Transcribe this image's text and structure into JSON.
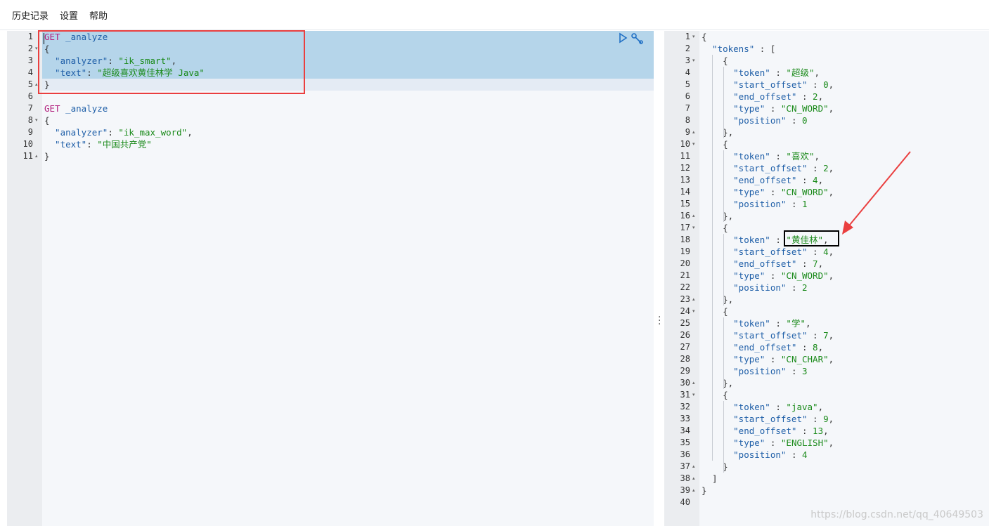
{
  "menu": [
    "历史记录",
    "设置",
    "帮助"
  ],
  "request": {
    "lines": [
      {
        "n": "1",
        "fold": "",
        "parts": [
          {
            "c": "k-get",
            "t": "GET"
          },
          {
            "c": "k-path",
            "t": " _analyze"
          }
        ]
      },
      {
        "n": "2",
        "fold": "▾",
        "parts": [
          {
            "c": "k-punct",
            "t": "{"
          }
        ]
      },
      {
        "n": "3",
        "fold": "",
        "parts": [
          {
            "c": "k-key",
            "t": "  \"analyzer\""
          },
          {
            "c": "k-punct",
            "t": ": "
          },
          {
            "c": "k-str",
            "t": "\"ik_smart\""
          },
          {
            "c": "k-punct",
            "t": ","
          }
        ]
      },
      {
        "n": "4",
        "fold": "",
        "parts": [
          {
            "c": "k-key",
            "t": "  \"text\""
          },
          {
            "c": "k-punct",
            "t": ": "
          },
          {
            "c": "k-str",
            "t": "\"超级喜欢黄佳林学 Java\""
          }
        ]
      },
      {
        "n": "5",
        "fold": "▴",
        "parts": [
          {
            "c": "k-punct",
            "t": "}"
          }
        ]
      },
      {
        "n": "6",
        "fold": "",
        "parts": []
      },
      {
        "n": "7",
        "fold": "",
        "parts": [
          {
            "c": "k-get",
            "t": "GET"
          },
          {
            "c": "k-path",
            "t": " _analyze"
          }
        ]
      },
      {
        "n": "8",
        "fold": "▾",
        "parts": [
          {
            "c": "k-punct",
            "t": "{"
          }
        ]
      },
      {
        "n": "9",
        "fold": "",
        "parts": [
          {
            "c": "k-key",
            "t": "  \"analyzer\""
          },
          {
            "c": "k-punct",
            "t": ": "
          },
          {
            "c": "k-str",
            "t": "\"ik_max_word\""
          },
          {
            "c": "k-punct",
            "t": ","
          }
        ]
      },
      {
        "n": "10",
        "fold": "",
        "parts": [
          {
            "c": "k-key",
            "t": "  \"text\""
          },
          {
            "c": "k-punct",
            "t": ": "
          },
          {
            "c": "k-str",
            "t": "\"中国共产党\""
          }
        ]
      },
      {
        "n": "11",
        "fold": "▴",
        "parts": [
          {
            "c": "k-punct",
            "t": "}"
          }
        ]
      }
    ]
  },
  "response": {
    "lines": [
      {
        "n": "1",
        "fold": "▾",
        "parts": [
          {
            "c": "k-punct",
            "t": "{"
          }
        ]
      },
      {
        "n": "2",
        "fold": "",
        "parts": [
          {
            "c": "k-key",
            "t": "  \"tokens\""
          },
          {
            "c": "k-punct",
            "t": " : ["
          }
        ]
      },
      {
        "n": "3",
        "fold": "▾",
        "parts": [
          {
            "c": "k-punct",
            "t": "    {"
          }
        ]
      },
      {
        "n": "4",
        "fold": "",
        "parts": [
          {
            "c": "k-key",
            "t": "      \"token\""
          },
          {
            "c": "k-punct",
            "t": " : "
          },
          {
            "c": "k-str",
            "t": "\"超级\""
          },
          {
            "c": "k-punct",
            "t": ","
          }
        ]
      },
      {
        "n": "5",
        "fold": "",
        "parts": [
          {
            "c": "k-key",
            "t": "      \"start_offset\""
          },
          {
            "c": "k-punct",
            "t": " : "
          },
          {
            "c": "k-num",
            "t": "0"
          },
          {
            "c": "k-punct",
            "t": ","
          }
        ]
      },
      {
        "n": "6",
        "fold": "",
        "parts": [
          {
            "c": "k-key",
            "t": "      \"end_offset\""
          },
          {
            "c": "k-punct",
            "t": " : "
          },
          {
            "c": "k-num",
            "t": "2"
          },
          {
            "c": "k-punct",
            "t": ","
          }
        ]
      },
      {
        "n": "7",
        "fold": "",
        "parts": [
          {
            "c": "k-key",
            "t": "      \"type\""
          },
          {
            "c": "k-punct",
            "t": " : "
          },
          {
            "c": "k-str",
            "t": "\"CN_WORD\""
          },
          {
            "c": "k-punct",
            "t": ","
          }
        ]
      },
      {
        "n": "8",
        "fold": "",
        "parts": [
          {
            "c": "k-key",
            "t": "      \"position\""
          },
          {
            "c": "k-punct",
            "t": " : "
          },
          {
            "c": "k-num",
            "t": "0"
          }
        ]
      },
      {
        "n": "9",
        "fold": "▴",
        "parts": [
          {
            "c": "k-punct",
            "t": "    },"
          }
        ]
      },
      {
        "n": "10",
        "fold": "▾",
        "parts": [
          {
            "c": "k-punct",
            "t": "    {"
          }
        ]
      },
      {
        "n": "11",
        "fold": "",
        "parts": [
          {
            "c": "k-key",
            "t": "      \"token\""
          },
          {
            "c": "k-punct",
            "t": " : "
          },
          {
            "c": "k-str",
            "t": "\"喜欢\""
          },
          {
            "c": "k-punct",
            "t": ","
          }
        ]
      },
      {
        "n": "12",
        "fold": "",
        "parts": [
          {
            "c": "k-key",
            "t": "      \"start_offset\""
          },
          {
            "c": "k-punct",
            "t": " : "
          },
          {
            "c": "k-num",
            "t": "2"
          },
          {
            "c": "k-punct",
            "t": ","
          }
        ]
      },
      {
        "n": "13",
        "fold": "",
        "parts": [
          {
            "c": "k-key",
            "t": "      \"end_offset\""
          },
          {
            "c": "k-punct",
            "t": " : "
          },
          {
            "c": "k-num",
            "t": "4"
          },
          {
            "c": "k-punct",
            "t": ","
          }
        ]
      },
      {
        "n": "14",
        "fold": "",
        "parts": [
          {
            "c": "k-key",
            "t": "      \"type\""
          },
          {
            "c": "k-punct",
            "t": " : "
          },
          {
            "c": "k-str",
            "t": "\"CN_WORD\""
          },
          {
            "c": "k-punct",
            "t": ","
          }
        ]
      },
      {
        "n": "15",
        "fold": "",
        "parts": [
          {
            "c": "k-key",
            "t": "      \"position\""
          },
          {
            "c": "k-punct",
            "t": " : "
          },
          {
            "c": "k-num",
            "t": "1"
          }
        ]
      },
      {
        "n": "16",
        "fold": "▴",
        "parts": [
          {
            "c": "k-punct",
            "t": "    },"
          }
        ]
      },
      {
        "n": "17",
        "fold": "▾",
        "parts": [
          {
            "c": "k-punct",
            "t": "    {"
          }
        ]
      },
      {
        "n": "18",
        "fold": "",
        "parts": [
          {
            "c": "k-key",
            "t": "      \"token\""
          },
          {
            "c": "k-punct",
            "t": " : "
          },
          {
            "c": "k-str",
            "t": "\"黄佳林\""
          },
          {
            "c": "k-punct",
            "t": ","
          }
        ]
      },
      {
        "n": "19",
        "fold": "",
        "parts": [
          {
            "c": "k-key",
            "t": "      \"start_offset\""
          },
          {
            "c": "k-punct",
            "t": " : "
          },
          {
            "c": "k-num",
            "t": "4"
          },
          {
            "c": "k-punct",
            "t": ","
          }
        ]
      },
      {
        "n": "20",
        "fold": "",
        "parts": [
          {
            "c": "k-key",
            "t": "      \"end_offset\""
          },
          {
            "c": "k-punct",
            "t": " : "
          },
          {
            "c": "k-num",
            "t": "7"
          },
          {
            "c": "k-punct",
            "t": ","
          }
        ]
      },
      {
        "n": "21",
        "fold": "",
        "parts": [
          {
            "c": "k-key",
            "t": "      \"type\""
          },
          {
            "c": "k-punct",
            "t": " : "
          },
          {
            "c": "k-str",
            "t": "\"CN_WORD\""
          },
          {
            "c": "k-punct",
            "t": ","
          }
        ]
      },
      {
        "n": "22",
        "fold": "",
        "parts": [
          {
            "c": "k-key",
            "t": "      \"position\""
          },
          {
            "c": "k-punct",
            "t": " : "
          },
          {
            "c": "k-num",
            "t": "2"
          }
        ]
      },
      {
        "n": "23",
        "fold": "▴",
        "parts": [
          {
            "c": "k-punct",
            "t": "    },"
          }
        ]
      },
      {
        "n": "24",
        "fold": "▾",
        "parts": [
          {
            "c": "k-punct",
            "t": "    {"
          }
        ]
      },
      {
        "n": "25",
        "fold": "",
        "parts": [
          {
            "c": "k-key",
            "t": "      \"token\""
          },
          {
            "c": "k-punct",
            "t": " : "
          },
          {
            "c": "k-str",
            "t": "\"学\""
          },
          {
            "c": "k-punct",
            "t": ","
          }
        ]
      },
      {
        "n": "26",
        "fold": "",
        "parts": [
          {
            "c": "k-key",
            "t": "      \"start_offset\""
          },
          {
            "c": "k-punct",
            "t": " : "
          },
          {
            "c": "k-num",
            "t": "7"
          },
          {
            "c": "k-punct",
            "t": ","
          }
        ]
      },
      {
        "n": "27",
        "fold": "",
        "parts": [
          {
            "c": "k-key",
            "t": "      \"end_offset\""
          },
          {
            "c": "k-punct",
            "t": " : "
          },
          {
            "c": "k-num",
            "t": "8"
          },
          {
            "c": "k-punct",
            "t": ","
          }
        ]
      },
      {
        "n": "28",
        "fold": "",
        "parts": [
          {
            "c": "k-key",
            "t": "      \"type\""
          },
          {
            "c": "k-punct",
            "t": " : "
          },
          {
            "c": "k-str",
            "t": "\"CN_CHAR\""
          },
          {
            "c": "k-punct",
            "t": ","
          }
        ]
      },
      {
        "n": "29",
        "fold": "",
        "parts": [
          {
            "c": "k-key",
            "t": "      \"position\""
          },
          {
            "c": "k-punct",
            "t": " : "
          },
          {
            "c": "k-num",
            "t": "3"
          }
        ]
      },
      {
        "n": "30",
        "fold": "▴",
        "parts": [
          {
            "c": "k-punct",
            "t": "    },"
          }
        ]
      },
      {
        "n": "31",
        "fold": "▾",
        "parts": [
          {
            "c": "k-punct",
            "t": "    {"
          }
        ]
      },
      {
        "n": "32",
        "fold": "",
        "parts": [
          {
            "c": "k-key",
            "t": "      \"token\""
          },
          {
            "c": "k-punct",
            "t": " : "
          },
          {
            "c": "k-str",
            "t": "\"java\""
          },
          {
            "c": "k-punct",
            "t": ","
          }
        ]
      },
      {
        "n": "33",
        "fold": "",
        "parts": [
          {
            "c": "k-key",
            "t": "      \"start_offset\""
          },
          {
            "c": "k-punct",
            "t": " : "
          },
          {
            "c": "k-num",
            "t": "9"
          },
          {
            "c": "k-punct",
            "t": ","
          }
        ]
      },
      {
        "n": "34",
        "fold": "",
        "parts": [
          {
            "c": "k-key",
            "t": "      \"end_offset\""
          },
          {
            "c": "k-punct",
            "t": " : "
          },
          {
            "c": "k-num",
            "t": "13"
          },
          {
            "c": "k-punct",
            "t": ","
          }
        ]
      },
      {
        "n": "35",
        "fold": "",
        "parts": [
          {
            "c": "k-key",
            "t": "      \"type\""
          },
          {
            "c": "k-punct",
            "t": " : "
          },
          {
            "c": "k-str",
            "t": "\"ENGLISH\""
          },
          {
            "c": "k-punct",
            "t": ","
          }
        ]
      },
      {
        "n": "36",
        "fold": "",
        "parts": [
          {
            "c": "k-key",
            "t": "      \"position\""
          },
          {
            "c": "k-punct",
            "t": " : "
          },
          {
            "c": "k-num",
            "t": "4"
          }
        ]
      },
      {
        "n": "37",
        "fold": "▴",
        "parts": [
          {
            "c": "k-punct",
            "t": "    }"
          }
        ]
      },
      {
        "n": "38",
        "fold": "▴",
        "parts": [
          {
            "c": "k-punct",
            "t": "  ]"
          }
        ]
      },
      {
        "n": "39",
        "fold": "▴",
        "parts": [
          {
            "c": "k-punct",
            "t": "}"
          }
        ]
      },
      {
        "n": "40",
        "fold": "",
        "parts": []
      }
    ]
  },
  "watermark": "https://blog.csdn.net/qq_40649503",
  "colors": {
    "annotation_red": "#ea3f3f",
    "annotation_black": "#000000",
    "selection": "#b5d5ea"
  }
}
